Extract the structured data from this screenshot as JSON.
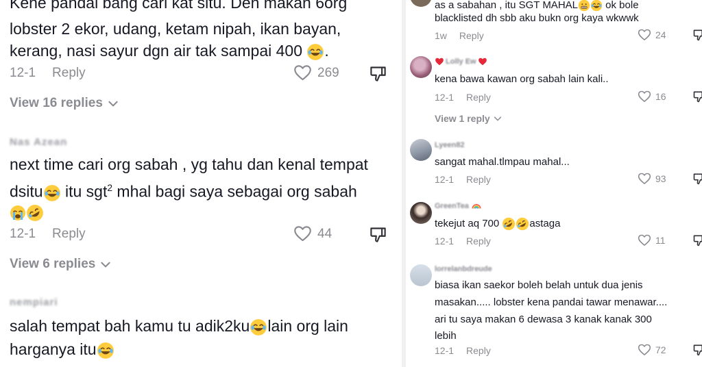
{
  "left": {
    "comment1": {
      "lines": [
        "Kene pandai bang cari kat situ. Den makan 6org",
        "lobster 2 ekor, udang, ketam nipah, ikan bayan,",
        "kerang, nasi sayur dgn air tak sampai 400"
      ],
      "date": "12-1",
      "reply": "Reply",
      "likes": "269",
      "view_replies": "View 16 replies"
    },
    "comment2": {
      "username": "Nas Azean",
      "line1": "next time cari org sabah , yg tahu dan kenal tempat",
      "line2_a": "dsitu",
      "line2_b": " itu sgt",
      "line2_sup": "2",
      "line2_c": " mhal bagi saya sebagai org sabah",
      "date": "12-1",
      "reply": "Reply",
      "likes": "44",
      "view_replies": "View 6 replies"
    },
    "comment3": {
      "username": "nempiari",
      "line1_a": "salah tempat bah kamu tu adik2ku",
      "line1_b": "lain org lain",
      "line2": "harganya itu"
    }
  },
  "right": {
    "c1": {
      "line0_a": "as a sabahan , itu SGT MAHAL",
      "line0_b": " ok bole",
      "line1": "blacklisted dh sbb aku bukn org kaya wkwwk",
      "date": "1w",
      "reply": "Reply",
      "likes": "24"
    },
    "c2": {
      "username": "Lolly Ew",
      "text": "kena bawa kawan org sabah lain kali..",
      "date": "12-1",
      "reply": "Reply",
      "likes": "16",
      "view_replies": "View 1 reply"
    },
    "c3": {
      "username": "Lyeen82",
      "text": "sangat mahal.tlmpau mahal...",
      "date": "12-1",
      "reply": "Reply",
      "likes": "93"
    },
    "c4": {
      "username": "GreenTea",
      "text_a": "tekejut aq 700 ",
      "text_b": "astaga",
      "date": "12-1",
      "reply": "Reply",
      "likes": "11"
    },
    "c5": {
      "username": "lorrelanbdreude",
      "lines": [
        "biasa ikan saekor boleh belah untuk dua jenis",
        "masakan..... lobster kena pandai tawar menawar....",
        "ari tu saya makan 6 dewasa 3 kanak kanak 300",
        "lebih"
      ],
      "date": "12-1",
      "reply": "Reply",
      "likes": "72"
    }
  },
  "colors": {
    "text": "#161823",
    "muted": "#8a8b91",
    "heart_red": "#fe2c55"
  },
  "icons": [
    "heart-outline-icon",
    "dislike-icon",
    "chevron-down-icon",
    "laughing-emoji-icon",
    "rofl-emoji-icon",
    "crying-emoji-icon",
    "grimace-emoji-icon",
    "rainbow-emoji-icon",
    "heart-emoji-icon"
  ]
}
